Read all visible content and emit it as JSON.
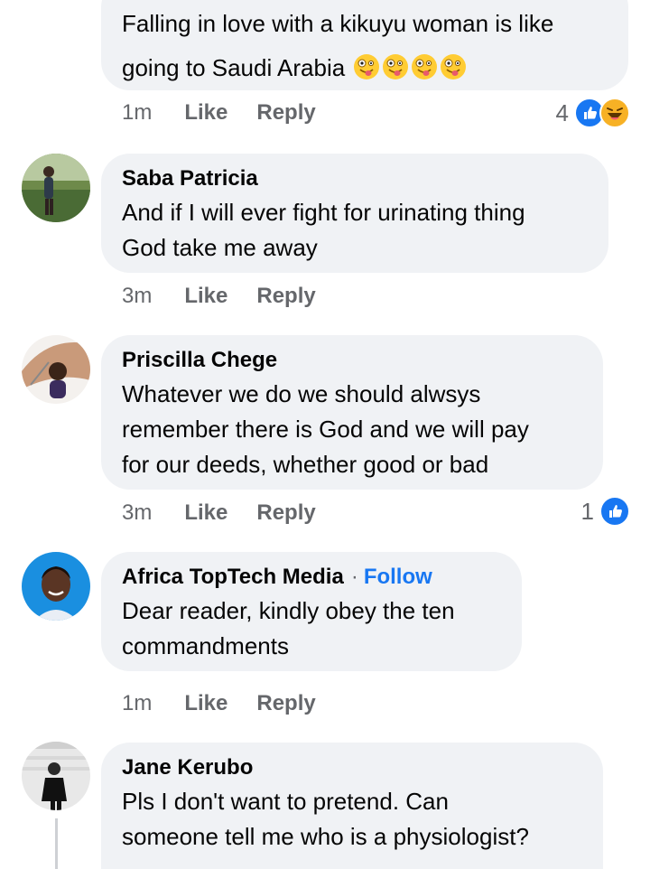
{
  "comments": [
    {
      "author": "",
      "text_lines": [
        "Falling in love with a kikuyu woman is like",
        "going to Saudi Arabia"
      ],
      "emoji": [
        "zany-face-emoji",
        "zany-face-emoji",
        "zany-face-emoji",
        "zany-face-emoji"
      ],
      "time": "1m",
      "like_label": "Like",
      "reply_label": "Reply",
      "reaction_count": "4",
      "reaction_icons": [
        "like-reaction-icon",
        "haha-reaction-icon"
      ]
    },
    {
      "author": "Saba Patricia",
      "text_lines": [
        "And if I will ever fight for urinating thing",
        "God take me away"
      ],
      "time": "3m",
      "like_label": "Like",
      "reply_label": "Reply"
    },
    {
      "author": "Priscilla Chege",
      "text_lines": [
        "Whatever we do we should alwsys",
        "remember there is God and we will pay",
        "for our deeds, whether good or bad"
      ],
      "time": "3m",
      "like_label": "Like",
      "reply_label": "Reply",
      "reaction_count": "1",
      "reaction_icons": [
        "like-reaction-icon"
      ]
    },
    {
      "author": "Africa TopTech Media",
      "separator": "·",
      "follow_label": "Follow",
      "text_lines": [
        "Dear reader, kindly obey the ten",
        "commandments"
      ],
      "time": "1m",
      "like_label": "Like",
      "reply_label": "Reply"
    },
    {
      "author": "Jane Kerubo",
      "text_lines": [
        "Pls I don't want to pretend. Can",
        "someone tell me who is a physiologist?"
      ]
    }
  ],
  "colors": {
    "bubble": "#f0f2f5",
    "meta": "#65676b",
    "link": "#1877f2",
    "like_blue": "#1877f2",
    "haha_yellow": "#f7b125"
  }
}
